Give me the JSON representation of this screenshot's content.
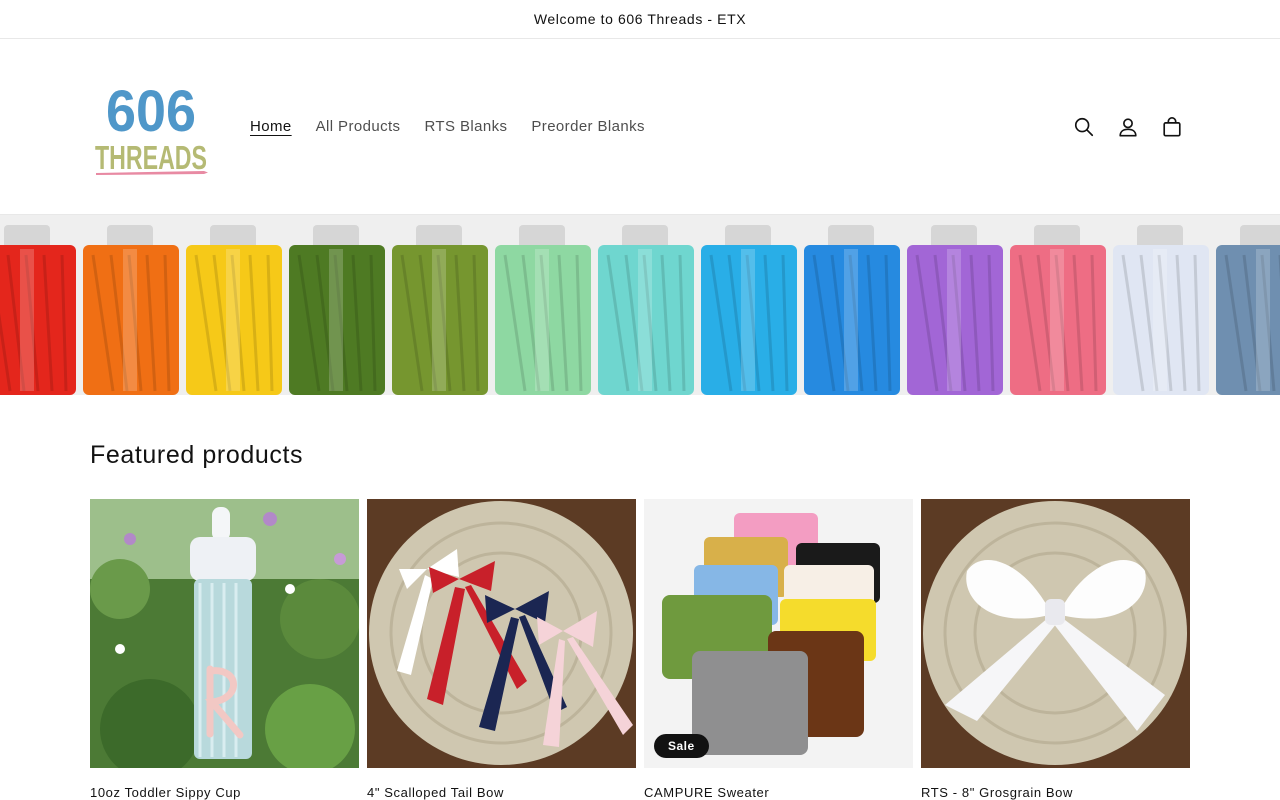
{
  "announcement": "Welcome to 606 Threads - ETX",
  "brand": {
    "logo_line1": "606",
    "logo_line2": "THREADS"
  },
  "nav": {
    "items": [
      {
        "label": "Home",
        "active": true
      },
      {
        "label": "All Products"
      },
      {
        "label": "RTS Blanks"
      },
      {
        "label": "Preorder Blanks"
      }
    ]
  },
  "header_icons": [
    "search-icon",
    "account-icon",
    "cart-icon"
  ],
  "colors": {
    "logo_blue": "#4f97c9",
    "logo_green": "#b5ba74",
    "needle_pink": "#e88aa3",
    "badge_bg": "#121212"
  },
  "banner": {
    "thread_colors": [
      "#e4261c",
      "#f06f14",
      "#f6c918",
      "#4e7a23",
      "#76962f",
      "#8ed8a2",
      "#6fd6cf",
      "#29aee7",
      "#268ae0",
      "#a266d6",
      "#ee6d84",
      "#e0e6f3",
      "#6f8fb0"
    ]
  },
  "featured": {
    "title": "Featured products",
    "products": [
      {
        "title": "10oz Toddler Sippy Cup",
        "badge": ""
      },
      {
        "title": "4\" Scalloped Tail Bow",
        "badge": ""
      },
      {
        "title": "CAMPURE Sweater",
        "badge": "Sale"
      },
      {
        "title": "RTS - 8\" Grosgrain Bow",
        "badge": ""
      }
    ]
  }
}
